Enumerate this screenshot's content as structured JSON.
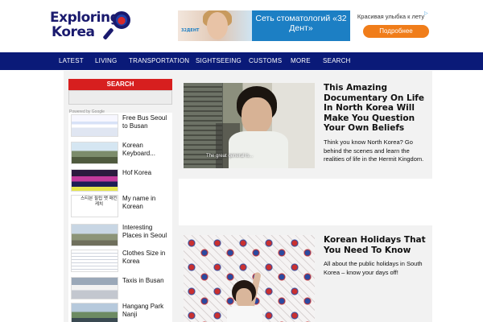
{
  "logo": {
    "line1": "Exploring",
    "line2": "Korea"
  },
  "ad": {
    "brand": "32ДЕНТ",
    "headline": "Сеть стоматологий «32 Дент»",
    "tagline": "Красивая улыбка к лету",
    "cta": "Подробнее"
  },
  "nav": {
    "items": [
      "LATEST",
      "LIVING",
      "TRANSPORTATION",
      "SIGHTSEEING",
      "CUSTOMS",
      "MORE",
      "SEARCH"
    ]
  },
  "sidebar": {
    "search_heading": "SEARCH",
    "powered_by": "Powered by Google",
    "items": [
      {
        "title": "Free Bus Seoul to Busan",
        "thumb": "t1"
      },
      {
        "title": "Korean Keyboard...",
        "thumb": "t2"
      },
      {
        "title": "Hof Korea",
        "thumb": "t3"
      },
      {
        "title": "My name in Korean",
        "thumb": "t4",
        "thumb_text": "스티븐  필립  맷  매킨  케치"
      },
      {
        "title": "Interesting Places in Seoul",
        "thumb": "t5"
      },
      {
        "title": "Clothes Size in Korea",
        "thumb": "t6"
      },
      {
        "title": "Taxis in Busan",
        "thumb": "t7"
      },
      {
        "title": "Hangang Park Nanji",
        "thumb": "t8"
      }
    ]
  },
  "articles": [
    {
      "title": "This Amazing Documentary On Life In North Korea Will Make You Question Your Own Beliefs",
      "excerpt": "Think you know North Korea? Go behind the scenes and learn the realities of life in the Hermit Kingdom.",
      "image_caption": "The great general is..."
    },
    {
      "title": "Korean Holidays That You Need To Know",
      "excerpt": "All about the public holidays in South Korea – know your days off!"
    }
  ],
  "colors": {
    "nav_bg": "#0a1a78",
    "search_red": "#d71f1f",
    "logo_blue": "#1a1a6e",
    "ad_blue": "#1c7fc4",
    "cta_orange": "#f07d1a"
  }
}
